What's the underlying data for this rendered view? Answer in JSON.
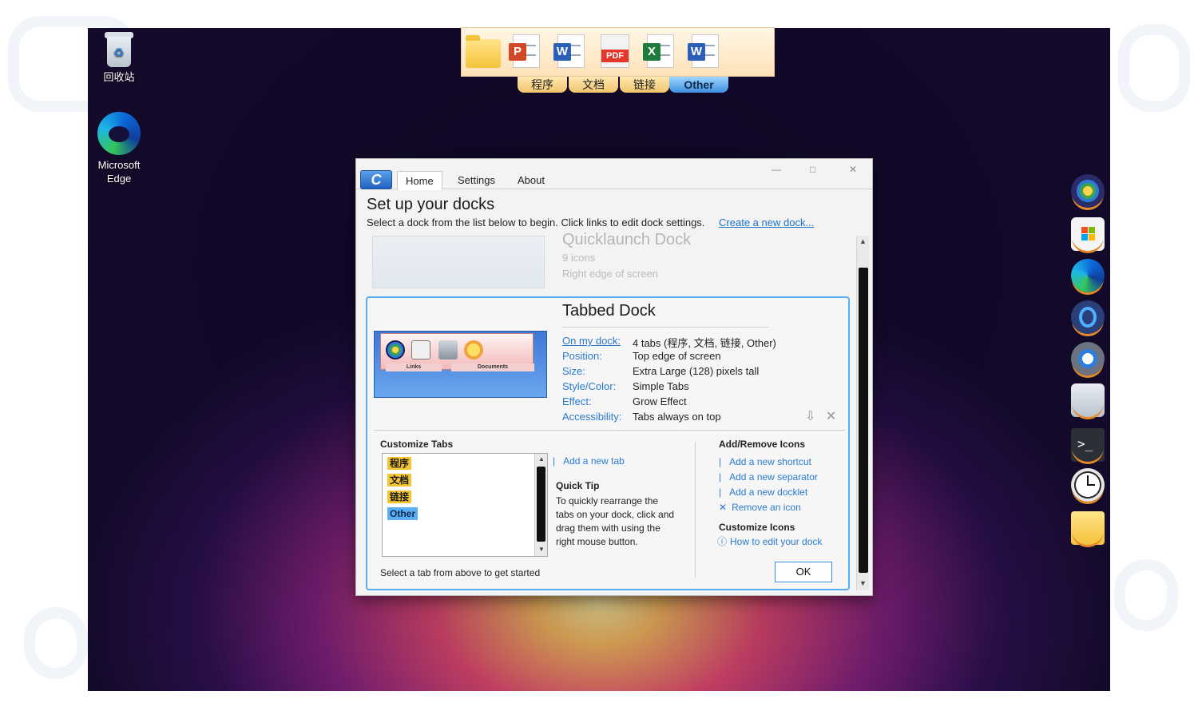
{
  "desktop": {
    "icons": [
      {
        "label": "回收站"
      },
      {
        "label": "Microsoft Edge"
      }
    ]
  },
  "top_dock": {
    "icons": [
      "folder-icon",
      "powerpoint-icon",
      "word-icon",
      "pdf-icon",
      "excel-icon",
      "word-icon"
    ],
    "pdf_text": "PDF",
    "tabs": [
      "程序",
      "文档",
      "链接",
      "Other"
    ],
    "active_tab": "Other"
  },
  "right_dock": {
    "icons": [
      "windows-start-icon",
      "store-icon",
      "edge-icon",
      "app-icon",
      "settings-icon",
      "recycle-bin-icon",
      "terminal-icon",
      "clock-icon",
      "folder-icon"
    ]
  },
  "window": {
    "app_badge": "C",
    "tabs": [
      "Home",
      "Settings",
      "About"
    ],
    "active_tab": "Home",
    "controls": {
      "minimize": "—",
      "maximize": "□",
      "close": "✕"
    },
    "heading": "Set up your docks",
    "subheading": "Select a dock from the list below to begin. Click links to edit dock settings.",
    "create_link": "Create a new dock...",
    "faded_dock": {
      "title": "Quicklaunch Dock",
      "line1": "9 icons",
      "line2": "Right edge of screen"
    },
    "dock_card": {
      "title": "Tabbed Dock",
      "preview_tabs": [
        "Links",
        "Documents"
      ],
      "properties": [
        {
          "key": "On my dock:",
          "value": "4 tabs (程序, 文档, 链接, Other)"
        },
        {
          "key": "Position:",
          "value": "Top edge of screen"
        },
        {
          "key": "Size:",
          "value": "Extra Large (128) pixels tall"
        },
        {
          "key": "Style/Color:",
          "value": "Simple Tabs"
        },
        {
          "key": "Effect:",
          "value": "Grow Effect"
        },
        {
          "key": "Accessibility:",
          "value": "Tabs always on top"
        }
      ],
      "customize_tabs": {
        "title": "Customize Tabs",
        "items": [
          "程序",
          "文档",
          "链接",
          "Other"
        ],
        "hint": "Select a tab from above to get started"
      },
      "add_tab_link": "Add a new tab",
      "quick_tip": {
        "title": "Quick Tip",
        "lines": [
          "To quickly rearrange the",
          "tabs on your dock, click and",
          "drag them with using the",
          "right mouse button."
        ]
      },
      "add_remove": {
        "title": "Add/Remove Icons",
        "links": [
          "Add a new shortcut",
          "Add a new separator",
          "Add a new docklet",
          "Remove an icon"
        ]
      },
      "customize_icons": {
        "title": "Customize Icons",
        "link": "How to edit your dock"
      },
      "ok_label": "OK"
    }
  }
}
